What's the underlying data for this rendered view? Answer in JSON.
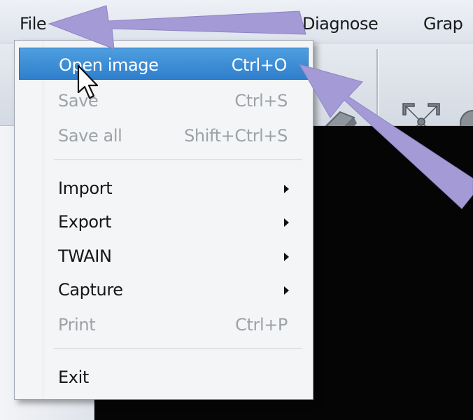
{
  "menubar": {
    "items": [
      "File",
      "Diagnose",
      "Grap"
    ]
  },
  "file_menu": {
    "items": [
      {
        "label": "Open image",
        "shortcut": "Ctrl+O",
        "state": "highlighted"
      },
      {
        "label": "Save",
        "shortcut": "Ctrl+S",
        "state": "disabled"
      },
      {
        "label": "Save all",
        "shortcut": "Shift+Ctrl+S",
        "state": "disabled"
      },
      {
        "label": "Import",
        "submenu": true,
        "state": "enabled"
      },
      {
        "label": "Export",
        "submenu": true,
        "state": "enabled"
      },
      {
        "label": "TWAIN",
        "submenu": true,
        "state": "enabled"
      },
      {
        "label": "Capture",
        "submenu": true,
        "state": "enabled"
      },
      {
        "label": "Print",
        "shortcut": "Ctrl+P",
        "state": "disabled"
      },
      {
        "label": "Exit",
        "state": "enabled"
      }
    ]
  },
  "colors": {
    "highlight": "#3a8ad6",
    "annotation_arrow": "#a49ad6",
    "image_area": "#050505"
  },
  "icons": [
    "move-tool-icon",
    "mouse-cursor-icon",
    "submenu-arrow-icon"
  ]
}
